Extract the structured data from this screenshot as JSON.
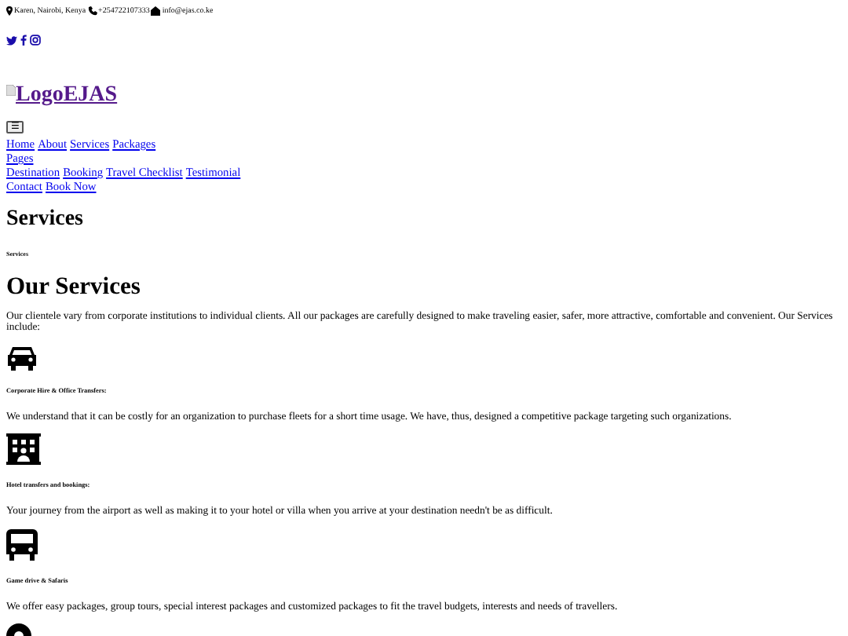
{
  "contact_bar": {
    "location": "Karen, Nairobi, Kenya",
    "phone": "+254722107333",
    "email": "info@ejas.co.ke"
  },
  "social_links": [
    {
      "kind": "twitter"
    },
    {
      "kind": "facebook"
    },
    {
      "kind": "instagram"
    }
  ],
  "logo": {
    "text": "LogoEJAS"
  },
  "menu_button": {
    "label": "☰"
  },
  "nav_lines": [
    [
      "Home",
      "About",
      "Services",
      "Packages"
    ],
    [
      "Pages"
    ],
    [
      "Destination",
      "Booking",
      "Travel Checklist",
      "Testimonial"
    ],
    [
      "Contact",
      "Book Now"
    ]
  ],
  "page_title": "Services",
  "breadcrumb": "Services",
  "section_title": "Our Services",
  "intro": "Our clientele vary from corporate institutions to individual clients. All our packages are carefully designed to make traveling easier, safer, more attractive, comfortable and convenient. Our Services include:",
  "services": [
    {
      "kind": "car",
      "title": "Corporate Hire & Office Transfers:",
      "text": "We understand that it can be costly for an organization to purchase fleets for a short time usage. We have, thus, designed a competitive package targeting such organizations."
    },
    {
      "kind": "hotel",
      "title": "Hotel transfers and bookings:",
      "text": "Your journey from the airport as well as making it to your hotel or villa when you arrive at your destination needn't be as difficult."
    },
    {
      "kind": "bus",
      "title": "Game drive & Safaris",
      "text": "We offer easy packages, group tours, special interest packages and customized packages to fit the travel budgets, interests and needs of travellers."
    },
    {
      "kind": "pin"
    }
  ]
}
